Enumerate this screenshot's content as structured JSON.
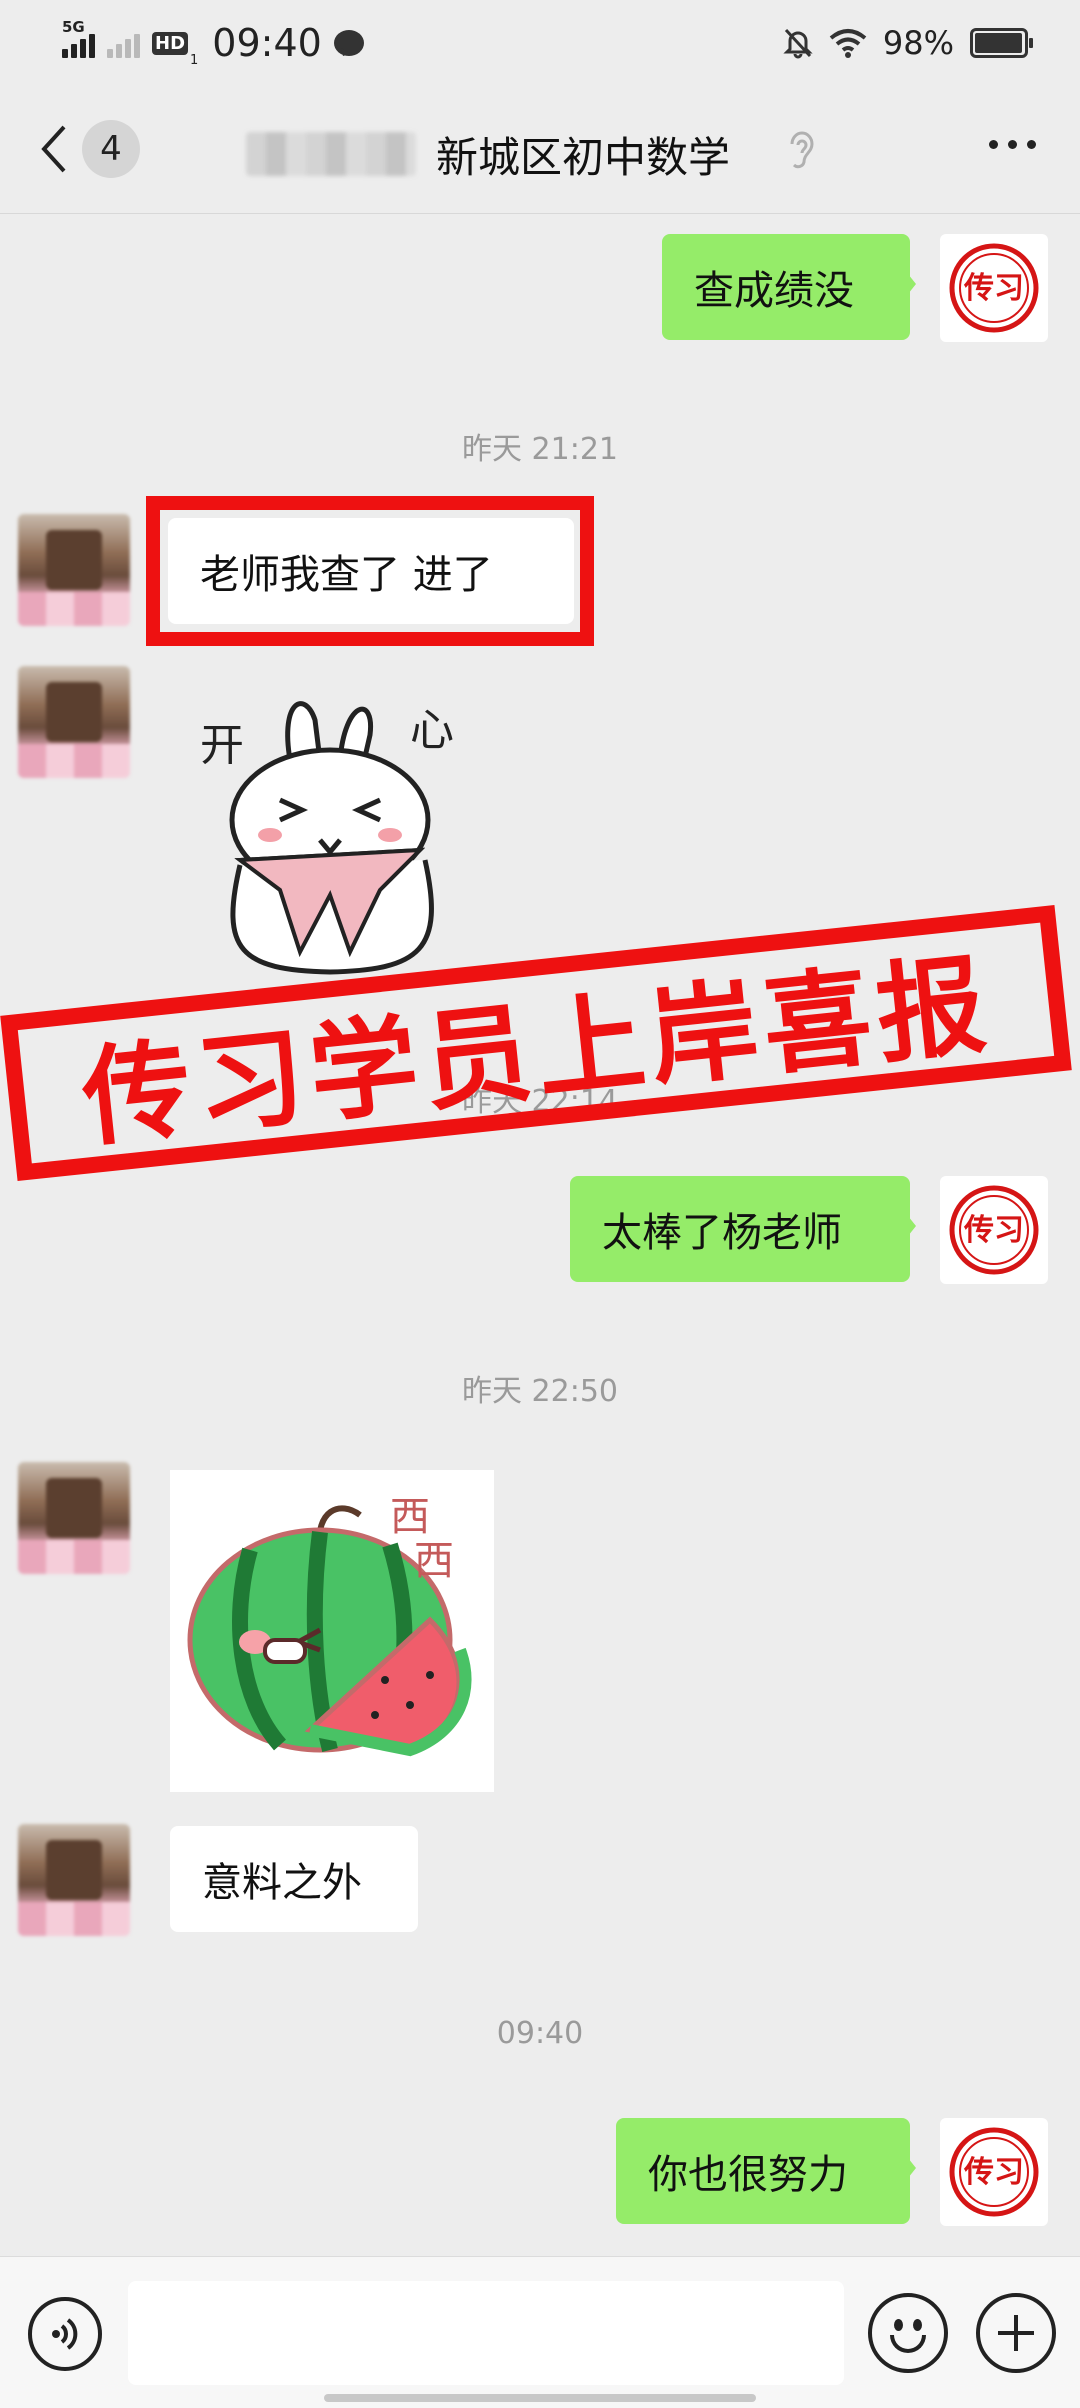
{
  "status_bar": {
    "network": "5G",
    "hd_label": "HD",
    "hd_sub": "1",
    "time": "09:40",
    "battery": "98%",
    "battery_level": 0.98
  },
  "header": {
    "unread_count": "4",
    "title": "新城区初中数学"
  },
  "messages": [
    {
      "side": "me",
      "text": "查成绩没"
    },
    {
      "timestamp": "昨天 21:21"
    },
    {
      "side": "other",
      "text": "老师我查了  进了"
    },
    {
      "side": "other",
      "sticker": "rabbit-sticker",
      "sticker_text": "开心"
    },
    {
      "timestamp": "昨天 22:14"
    },
    {
      "side": "me",
      "text": "太棒了杨老师"
    },
    {
      "timestamp": "昨天 22:50"
    },
    {
      "side": "other",
      "sticker": "watermelon-sticker",
      "sticker_text": "西西"
    },
    {
      "side": "other",
      "text": "意料之外"
    },
    {
      "timestamp": "09:40"
    },
    {
      "side": "me",
      "text": "你也很努力"
    }
  ],
  "banner": {
    "text": "传习学员上岸喜报"
  },
  "brand_seal": {
    "text": "传习"
  },
  "colors": {
    "background": "#ededed",
    "my_bubble": "#95ec69",
    "other_bubble": "#ffffff",
    "stamp_red": "#ee1111"
  },
  "icons": {
    "back": "chevron-left-icon",
    "ear": "ear-icon",
    "more": "more-dots-icon",
    "voice": "voice-icon",
    "emoji": "emoji-icon",
    "plus": "plus-icon"
  }
}
